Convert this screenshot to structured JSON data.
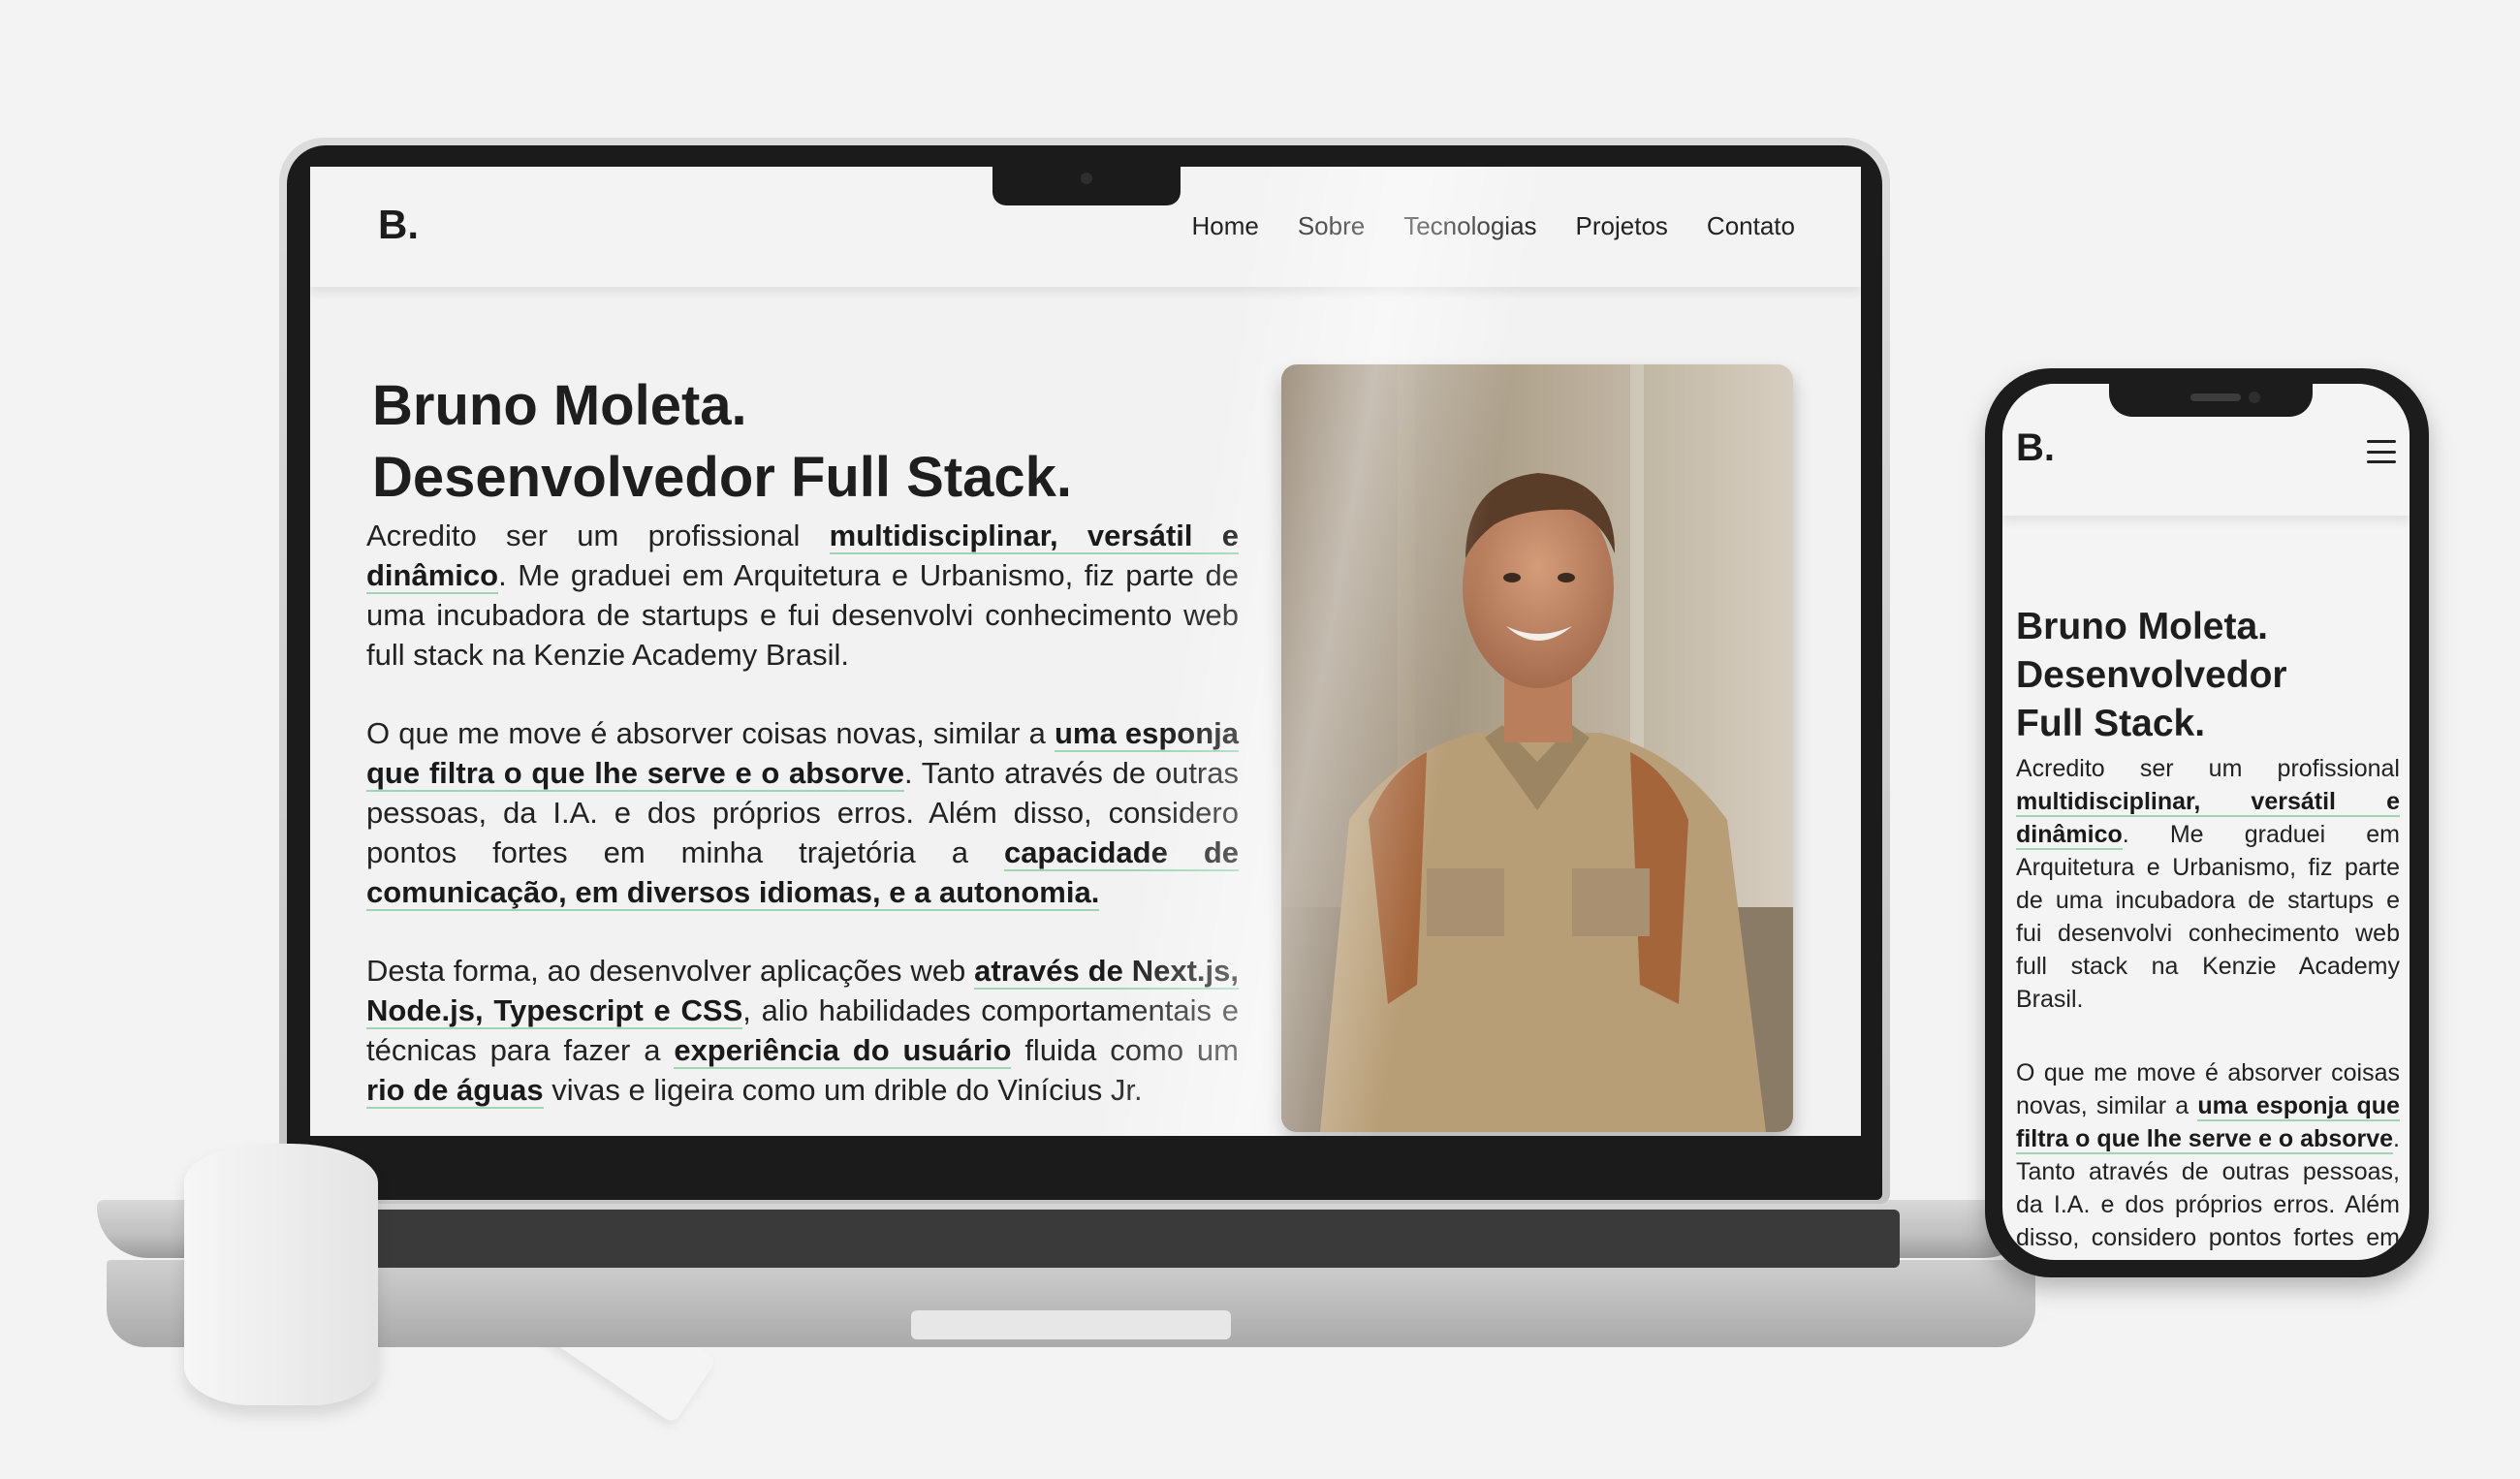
{
  "site": {
    "logo": "B.",
    "nav": [
      "Home",
      "Sobre",
      "Tecnologias",
      "Projetos",
      "Contato"
    ],
    "hero": {
      "name_line": "Bruno Moleta.",
      "role_line": "Desenvolvedor Full Stack.",
      "mobile_role_line_1": "Desenvolvedor",
      "mobile_role_line_2": "Full Stack.",
      "p1": {
        "t1": "Acredito ser um profissional ",
        "h1": "multidisciplinar, versátil e dinâmico",
        "t2": ". Me graduei em Arquitetura e Urbanismo, fiz parte de uma incubadora de startups e fui desenvolvi conhecimento web full stack na Kenzie Academy Brasil."
      },
      "p2": {
        "t1": "O que me move é absorver coisas novas, similar a ",
        "h1": "uma esponja que filtra o que lhe serve e o absorve",
        "t2": ". Tanto através de outras pessoas, da I.A. e dos próprios erros. Além disso, considero pontos fortes em minha trajetória a ",
        "h2": "capacidade de comunicação, em diversos idiomas, e a autonomia."
      },
      "p3": {
        "t1": "Desta forma, ao desenvolver aplicações web ",
        "h1": "através de Next.js, Node.js, Typescript e CSS",
        "t2": ", alio habilidades comportamentais e técnicas para fazer a ",
        "h2": "experiência do usuário",
        "t3": " fluida como um ",
        "h3": "rio de águas",
        "t4": " vivas e ligeira como um drible do Vinícius Jr."
      }
    }
  },
  "icons": {
    "mobile_menu": "hamburger-menu-icon"
  },
  "colors": {
    "highlight_underline": "#9ed6b4",
    "page_bg": "#f2f2f2",
    "text": "#1c1c1c"
  }
}
